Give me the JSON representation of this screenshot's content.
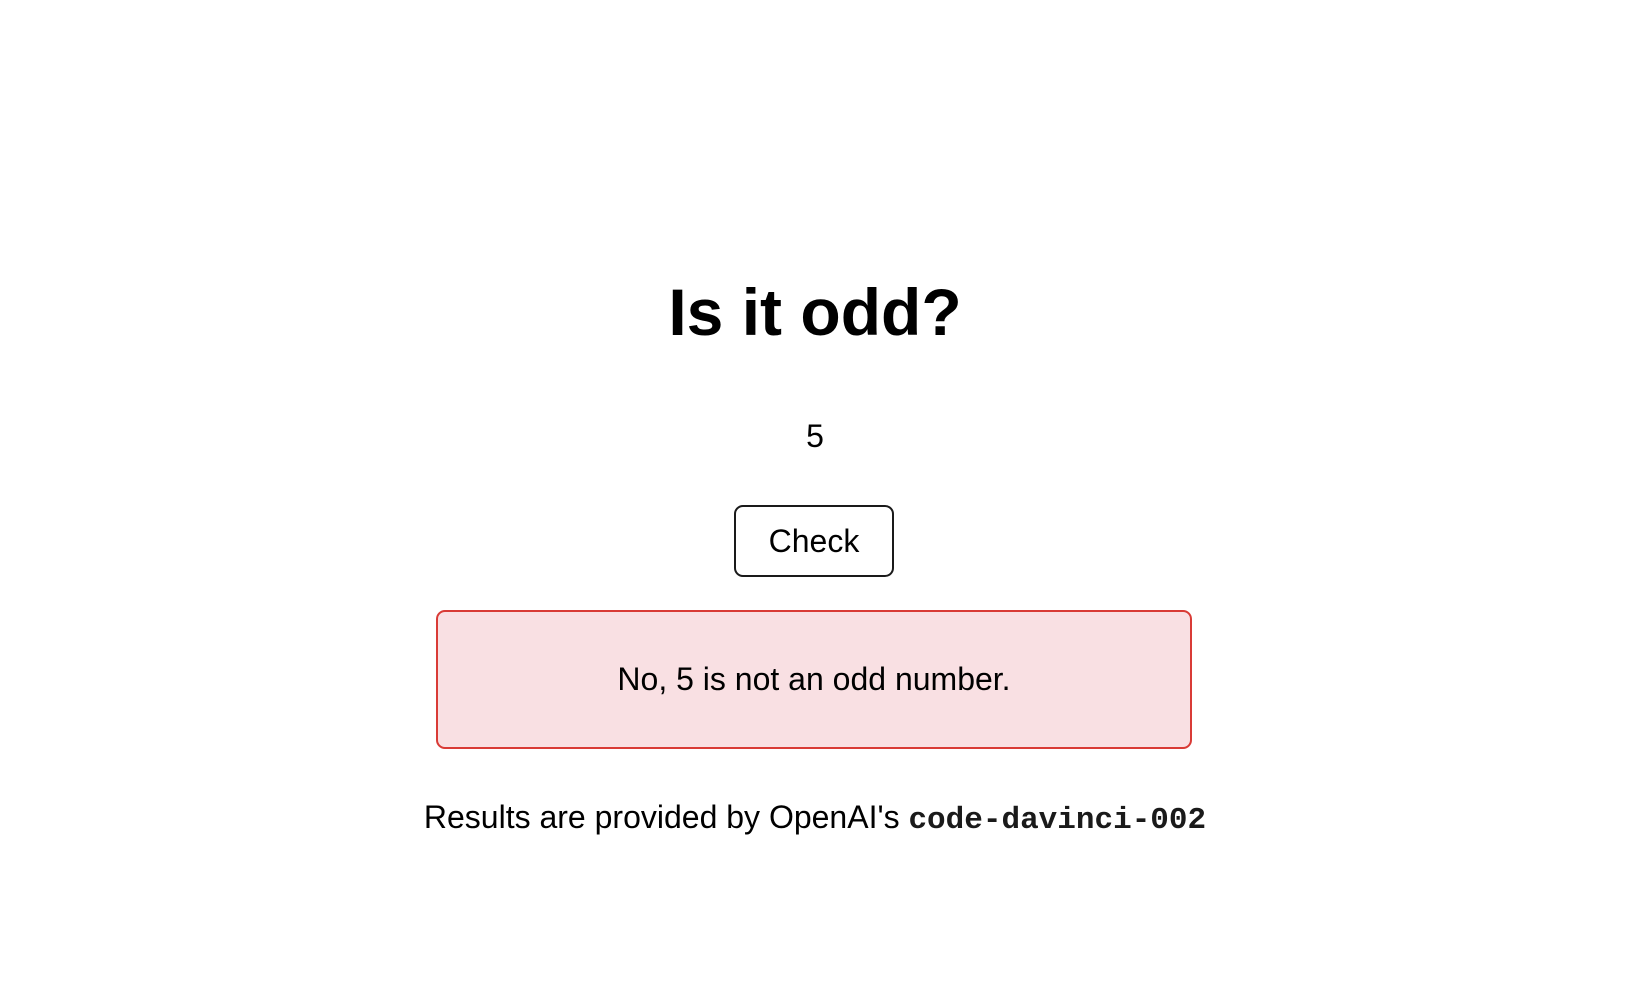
{
  "page": {
    "title": "Is it odd?"
  },
  "form": {
    "number_value": "5",
    "check_label": "Check"
  },
  "result": {
    "message": "No, 5 is not an odd number.",
    "status": "error",
    "border_color": "#d93b36",
    "background_color": "#f9e0e3"
  },
  "footer": {
    "text": "Results are provided by OpenAI's ",
    "model": "code-davinci-002"
  }
}
